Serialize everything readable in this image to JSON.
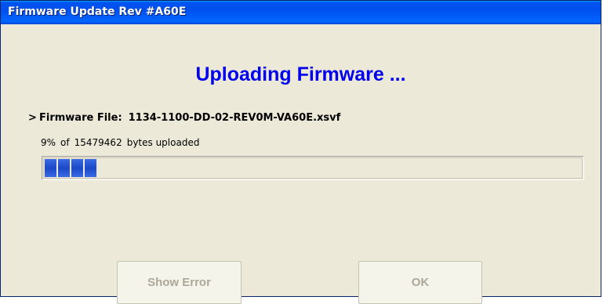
{
  "window": {
    "title": "Firmware Update  Rev #A60E"
  },
  "main": {
    "heading": "Uploading Firmware ...",
    "file_marker": ">",
    "file_label": "Firmware File:",
    "file_name": "1134-1100-DD-02-REV0M-VA60E.xsvf",
    "progress_percent_text": "9%",
    "progress_of": "of",
    "total_bytes": "15479462",
    "progress_suffix": "bytes uploaded",
    "progress_fraction": 0.09,
    "progress_chunks_filled": 4,
    "accent_color": "#1b48c8"
  },
  "buttons": {
    "show_error_label": "Show Error",
    "ok_label": "OK",
    "show_error_enabled": false,
    "ok_enabled": false
  }
}
